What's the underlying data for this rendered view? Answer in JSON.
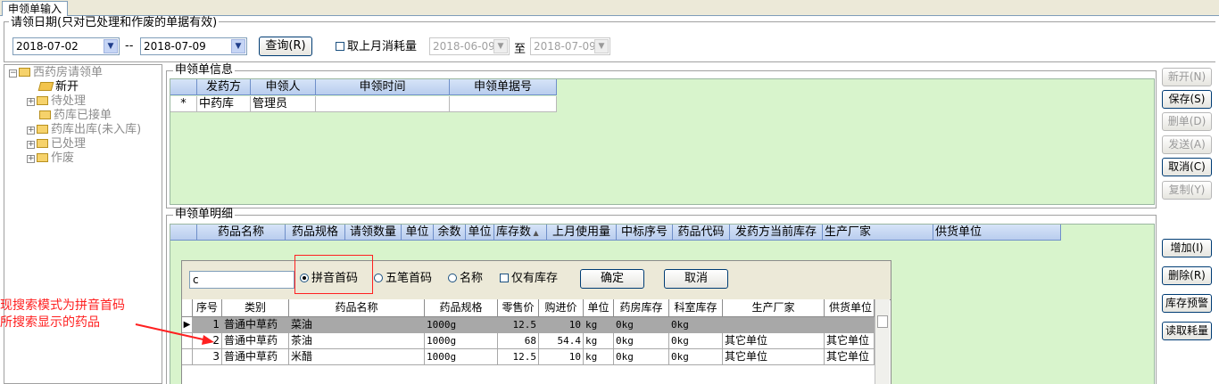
{
  "window": {
    "tab_label": "申领单输入"
  },
  "date_filter": {
    "legend": "请领日期(只对已处理和作废的单据有效)",
    "from_date": "2018-07-02",
    "separator": "--",
    "to_date": "2018-07-09",
    "query_button": "查询(R)",
    "last_month_checkbox": "取上月消耗量",
    "last_month_from": "2018-06-09",
    "to_label": "至",
    "last_month_to": "2018-07-09"
  },
  "tree": {
    "root": "西药房请领单",
    "items": [
      "新开",
      "待处理",
      "药库已接单",
      "药库出库(未入库)",
      "已处理",
      "作废"
    ]
  },
  "info_section": {
    "legend": "申领单信息",
    "columns": [
      "发药方",
      "申领人",
      "申领时间",
      "申领单据号"
    ],
    "new_row_marker": "*",
    "row": [
      "中药库",
      "管理员",
      "",
      ""
    ]
  },
  "detail_section": {
    "legend": "申领单明细",
    "columns": [
      "药品名称",
      "药品规格",
      "请领数量",
      "单位",
      "余数",
      "单位",
      "库存数",
      "上月使用量",
      "中标序号",
      "药品代码",
      "发药方当前库存",
      "生产厂家",
      "供货单位"
    ]
  },
  "right_buttons": [
    {
      "label": "新开(N)",
      "enabled": false
    },
    {
      "label": "保存(S)",
      "enabled": true
    },
    {
      "label": "删单(D)",
      "enabled": false
    },
    {
      "label": "发送(A)",
      "enabled": false
    },
    {
      "label": "取消(C)",
      "enabled": true
    },
    {
      "label": "复制(Y)",
      "enabled": false
    },
    {
      "label": "增加(I)",
      "enabled": true
    },
    {
      "label": "删除(R)",
      "enabled": true
    },
    {
      "label": "库存预警",
      "enabled": true
    },
    {
      "label": "读取耗量",
      "enabled": true
    }
  ],
  "search_popup": {
    "input_value": "c",
    "radio_pinyin": "拼音首码",
    "radio_wubi": "五笔首码",
    "radio_name": "名称",
    "checkbox_stock_only": "仅有库存",
    "confirm_button": "确定",
    "cancel_button": "取消",
    "columns": [
      "序号",
      "类别",
      "药品名称",
      "药品规格",
      "零售价",
      "购进价",
      "单位",
      "药房库存",
      "科室库存",
      "生产厂家",
      "供货单位"
    ],
    "rows": [
      [
        "1",
        "普通中草药",
        "菜油",
        "1000g",
        "12.5",
        "10",
        "kg",
        "0kg",
        "0kg",
        "",
        ""
      ],
      [
        "2",
        "普通中草药",
        "茶油",
        "1000g",
        "68",
        "54.4",
        "kg",
        "0kg",
        "0kg",
        "其它单位",
        "其它单位"
      ],
      [
        "3",
        "普通中草药",
        "米醋",
        "1000g",
        "12.5",
        "10",
        "kg",
        "0kg",
        "0kg",
        "其它单位",
        "其它单位"
      ]
    ]
  },
  "annotation": {
    "line1": "现搜索模式为拼音首码",
    "line2": "所搜索显示的药品"
  }
}
